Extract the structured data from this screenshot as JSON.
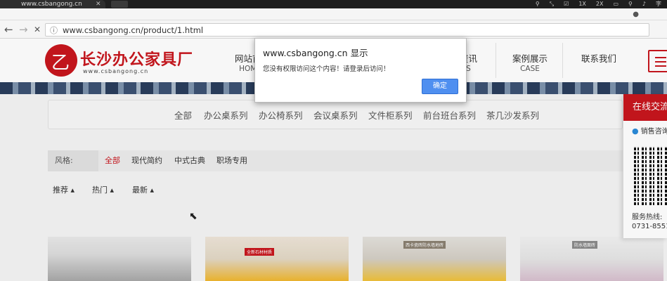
{
  "browser": {
    "tab_title": "www.csbangong.cn",
    "tab_close": "✕",
    "system_icons": [
      "⚲",
      "⤡",
      "☑",
      "1X",
      "2X",
      "▭",
      "⚲",
      "♪",
      "字"
    ],
    "profile_icon": "●",
    "back": "←",
    "forward": "→",
    "reload": "✕",
    "url": "www.csbangong.cn/product/1.html",
    "page_icon": "ⓘ"
  },
  "header": {
    "logo_glyph": "乙",
    "site_name": "长沙办公家具厂",
    "site_url": "www.csbangong.cn",
    "nav": [
      {
        "zh": "网站首",
        "en": "HOM"
      },
      {
        "zh": "资讯",
        "en": "S"
      },
      {
        "zh": "案例展示",
        "en": "CASE"
      },
      {
        "zh": "联系我们",
        "en": ""
      }
    ]
  },
  "categories": [
    "全部",
    "办公桌系列",
    "办公椅系列",
    "会议桌系列",
    "文件柜系列",
    "前台班台系列",
    "茶几沙发系列"
  ],
  "filter": {
    "label": "风格:",
    "options": [
      "全部",
      "现代简约",
      "中式古典",
      "职场专用"
    ]
  },
  "sort": [
    "推荐 ▴",
    "热门 ▴",
    "最新 ▴"
  ],
  "product_tags": [
    "",
    "全新石材材质",
    "西卡瓷砖防水墙地砖",
    "防水墙面砖"
  ],
  "service": {
    "title": "在线交流",
    "consult": "销售咨询",
    "phone_label": "服务热线:",
    "phone": "0731-8551"
  },
  "dialog": {
    "title": "www.csbangong.cn 显示",
    "message": "您没有权限访问这个内容！请登录后访问！",
    "ok": "确定"
  },
  "colors": {
    "brand": "#c8161d",
    "button": "#4f8ff0"
  }
}
